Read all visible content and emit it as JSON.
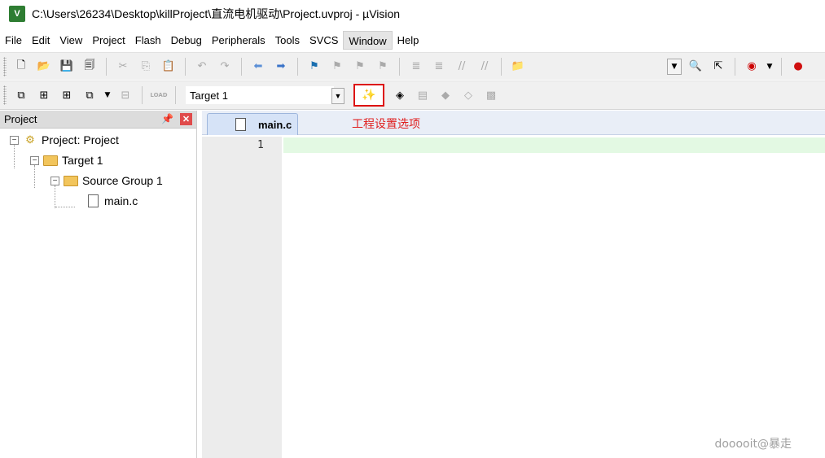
{
  "window": {
    "title": "C:\\Users\\26234\\Desktop\\killProject\\直流电机驱动\\Project.uvproj - µVision",
    "app_icon_text": "V"
  },
  "menu": {
    "items": [
      "File",
      "Edit",
      "View",
      "Project",
      "Flash",
      "Debug",
      "Peripherals",
      "Tools",
      "SVCS",
      "Window",
      "Help"
    ],
    "active": "Window"
  },
  "toolbar2": {
    "target_value": "Target 1",
    "load_label": "LOAD"
  },
  "project_panel": {
    "title": "Project",
    "tree": {
      "root": "Project: Project",
      "target": "Target 1",
      "group": "Source Group 1",
      "file": "main.c"
    }
  },
  "editor": {
    "tab_label": "main.c",
    "annotation": "工程设置选项",
    "line_number": "1"
  },
  "watermark": "dooooit@暴走",
  "colors": {
    "highlight_border": "#dd1111",
    "annotation_text": "#e02020",
    "current_line": "#e3f9e3"
  }
}
